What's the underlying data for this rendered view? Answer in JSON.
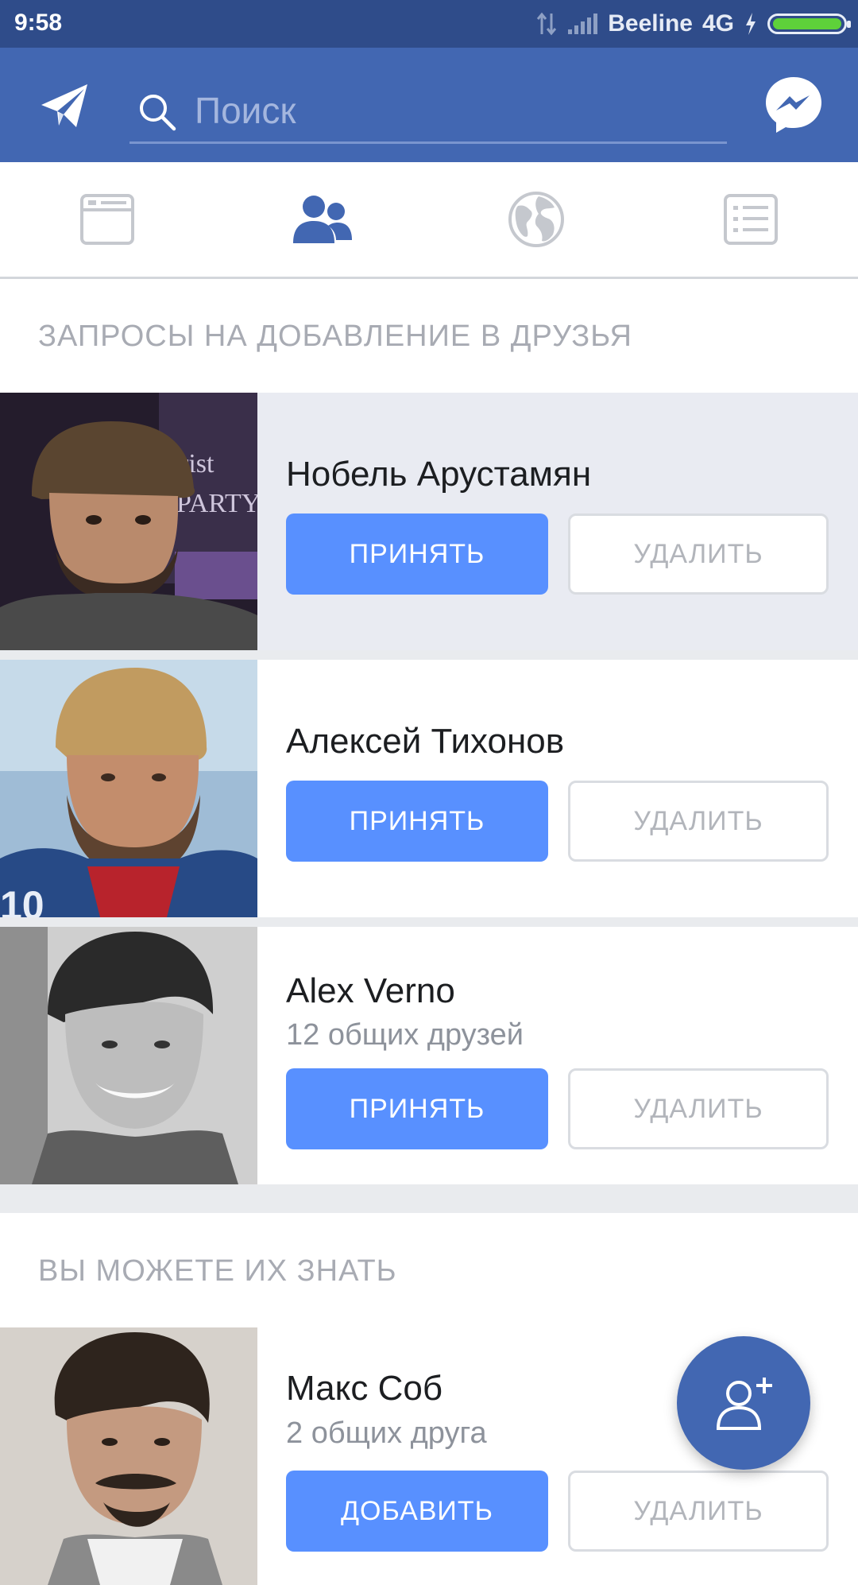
{
  "status_bar": {
    "time": "9:58",
    "carrier": "Beeline",
    "network": "4G",
    "battery_level": 1.0
  },
  "header": {
    "search_placeholder": "Поиск",
    "left_icon": "paper-plane-icon",
    "right_icon": "messenger-icon"
  },
  "tabs": [
    {
      "name": "news-feed",
      "icon": "news-feed-icon",
      "active": false
    },
    {
      "name": "friends",
      "icon": "friends-icon",
      "active": true
    },
    {
      "name": "globe",
      "icon": "globe-icon",
      "active": false
    },
    {
      "name": "menu",
      "icon": "menu-list-icon",
      "active": false
    }
  ],
  "requests_section": {
    "title": "ЗАПРОСЫ НА ДОБАВЛЕНИЕ В ДРУЗЬЯ",
    "items": [
      {
        "name": "Нобель Арустамян",
        "accept_label": "ПРИНЯТЬ",
        "delete_label": "УДАЛИТЬ"
      },
      {
        "name": "Алексей Тихонов",
        "accept_label": "ПРИНЯТЬ",
        "delete_label": "УДАЛИТЬ"
      },
      {
        "name": "Alex Verno",
        "mutual": "12 общих друзей",
        "accept_label": "ПРИНЯТЬ",
        "delete_label": "УДАЛИТЬ"
      }
    ]
  },
  "suggestions_section": {
    "title": "ВЫ МОЖЕТЕ ИХ ЗНАТЬ",
    "items": [
      {
        "name": "Макс Соб",
        "mutual": "2 общих друга",
        "add_label": "ДОБАВИТЬ",
        "delete_label": "УДАЛИТЬ"
      }
    ]
  },
  "colors": {
    "status_bar": "#2f4c8a",
    "header": "#4267b2",
    "primary_button": "#5890ff",
    "active_tab": "#4267b2",
    "inactive_tab": "#c5c8ce",
    "highlight_row": "#e9ebf2"
  },
  "fab": {
    "icon": "add-friend-icon"
  }
}
